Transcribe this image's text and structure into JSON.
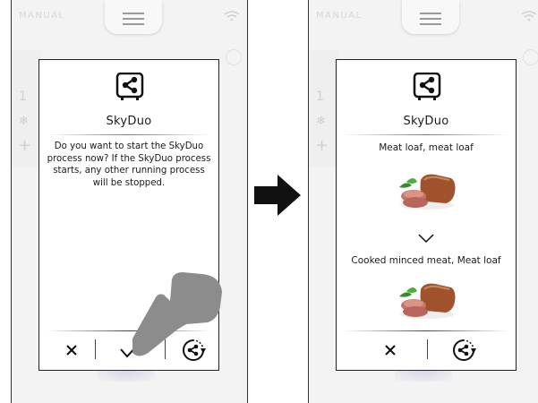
{
  "screens": [
    {
      "mode_label": "MANUAL",
      "side_number": "1",
      "dialog": {
        "title": "SkyDuo",
        "message": "Do you want to start the SkyDuo process now? If the SkyDuo process starts, any other running process will be stopped.",
        "buttons": [
          "cancel",
          "confirm",
          "skyduo-mode"
        ]
      }
    },
    {
      "mode_label": "MANUAL",
      "side_number": "1",
      "dialog": {
        "title": "SkyDuo",
        "from_dish": "Meat loaf, meat loaf",
        "to_dish": "Cooked minced meat, Meat loaf",
        "buttons": [
          "cancel",
          "skyduo-mode"
        ]
      }
    }
  ],
  "colors": {
    "screen_bg": "#f3f3f3",
    "dialog_bg": "#ffffff",
    "frame": "#222222",
    "hand": "#8c8c8c",
    "arrow": "#111111"
  },
  "icons": [
    "share-icon",
    "wifi-icon",
    "menu-icon",
    "close-icon",
    "check-icon",
    "skyduo-cycle-icon",
    "chevron-down-icon",
    "pointing-hand-icon",
    "right-arrow-icon"
  ]
}
